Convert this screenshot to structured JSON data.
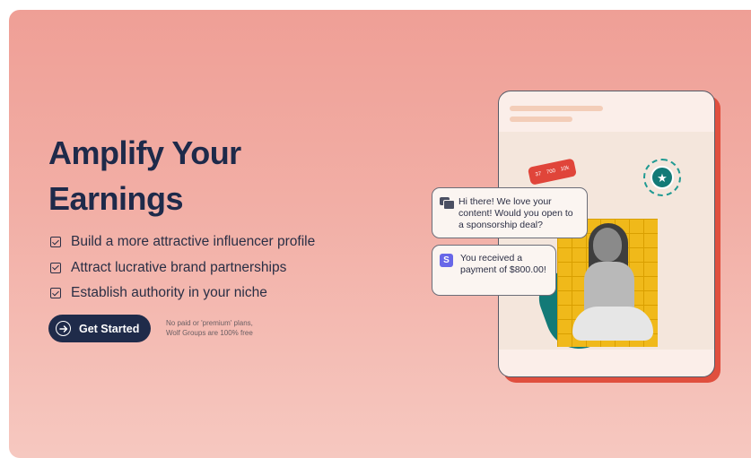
{
  "hero": {
    "headline_line1": "Amplify Your",
    "headline_line2": "Earnings",
    "features": [
      "Build a more attractive influencer profile",
      "Attract lucrative brand partnerships",
      "Establish authority in your niche"
    ],
    "cta_label": "Get Started",
    "note_line1": "No paid or 'premium' plans,",
    "note_line2": "Wolf Groups are 100% free"
  },
  "illustration": {
    "message_text": "Hi there! We love your content! Would you open to a sponsorship deal?",
    "payment_text": "You received a payment of $800.00!",
    "payment_icon_letter": "S",
    "stats": [
      "37",
      "700",
      "10k"
    ],
    "star": "★"
  },
  "colors": {
    "hero_top": "#ef9f96",
    "hero_bottom": "#f6c8c0",
    "navy": "#1f2b4a",
    "accent_red": "#e04f3e",
    "teal": "#137a77",
    "yellow": "#f0b91a",
    "stripe_purple": "#6867e8"
  }
}
